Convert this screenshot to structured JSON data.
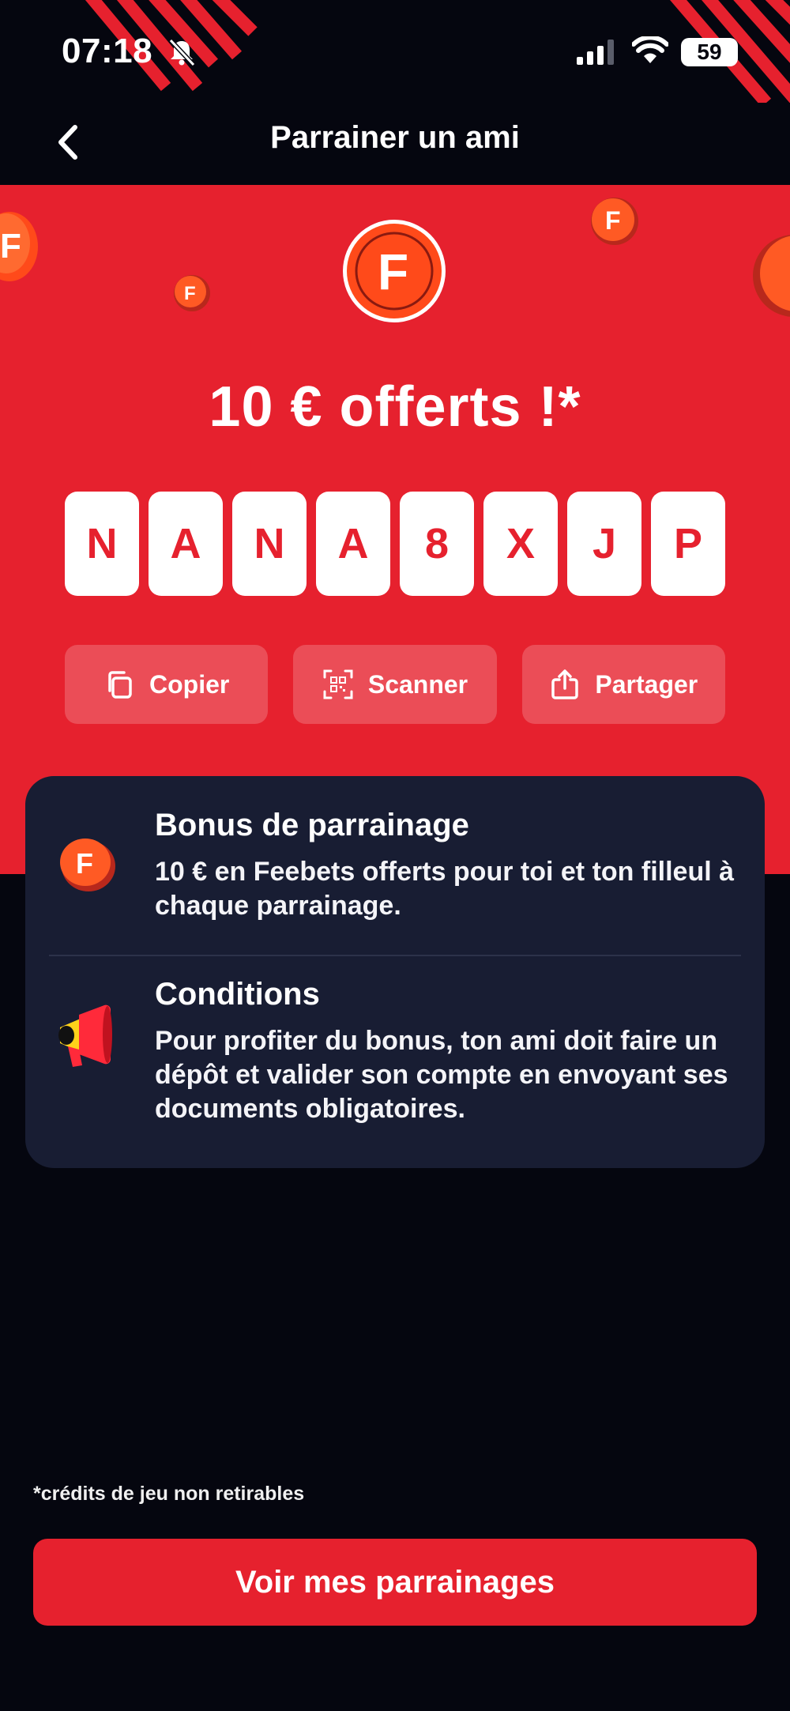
{
  "status_bar": {
    "time": "07:18",
    "battery": "59"
  },
  "header": {
    "title": "Parrainer un ami"
  },
  "hero": {
    "logo_letter": "F",
    "offer": "10 € offerts !*",
    "code_chars": [
      "N",
      "A",
      "N",
      "A",
      "8",
      "X",
      "J",
      "P"
    ],
    "actions": {
      "copy": "Copier",
      "scan": "Scanner",
      "share": "Partager"
    }
  },
  "info": {
    "bonus_title": "Bonus de parrainage",
    "bonus_text": "10 € en Feebets offerts pour toi et ton filleul à chaque parrainage.",
    "conditions_title": "Conditions",
    "conditions_text": "Pour profiter du bonus, ton ami doit faire un dépôt et valider son compte en envoyant ses documents obligatoires."
  },
  "footnote": "*crédits de jeu non retirables",
  "cta_label": "Voir mes parrainages",
  "colors": {
    "brand_red": "#e6212e",
    "background": "#05060f",
    "card": "#181d33"
  }
}
